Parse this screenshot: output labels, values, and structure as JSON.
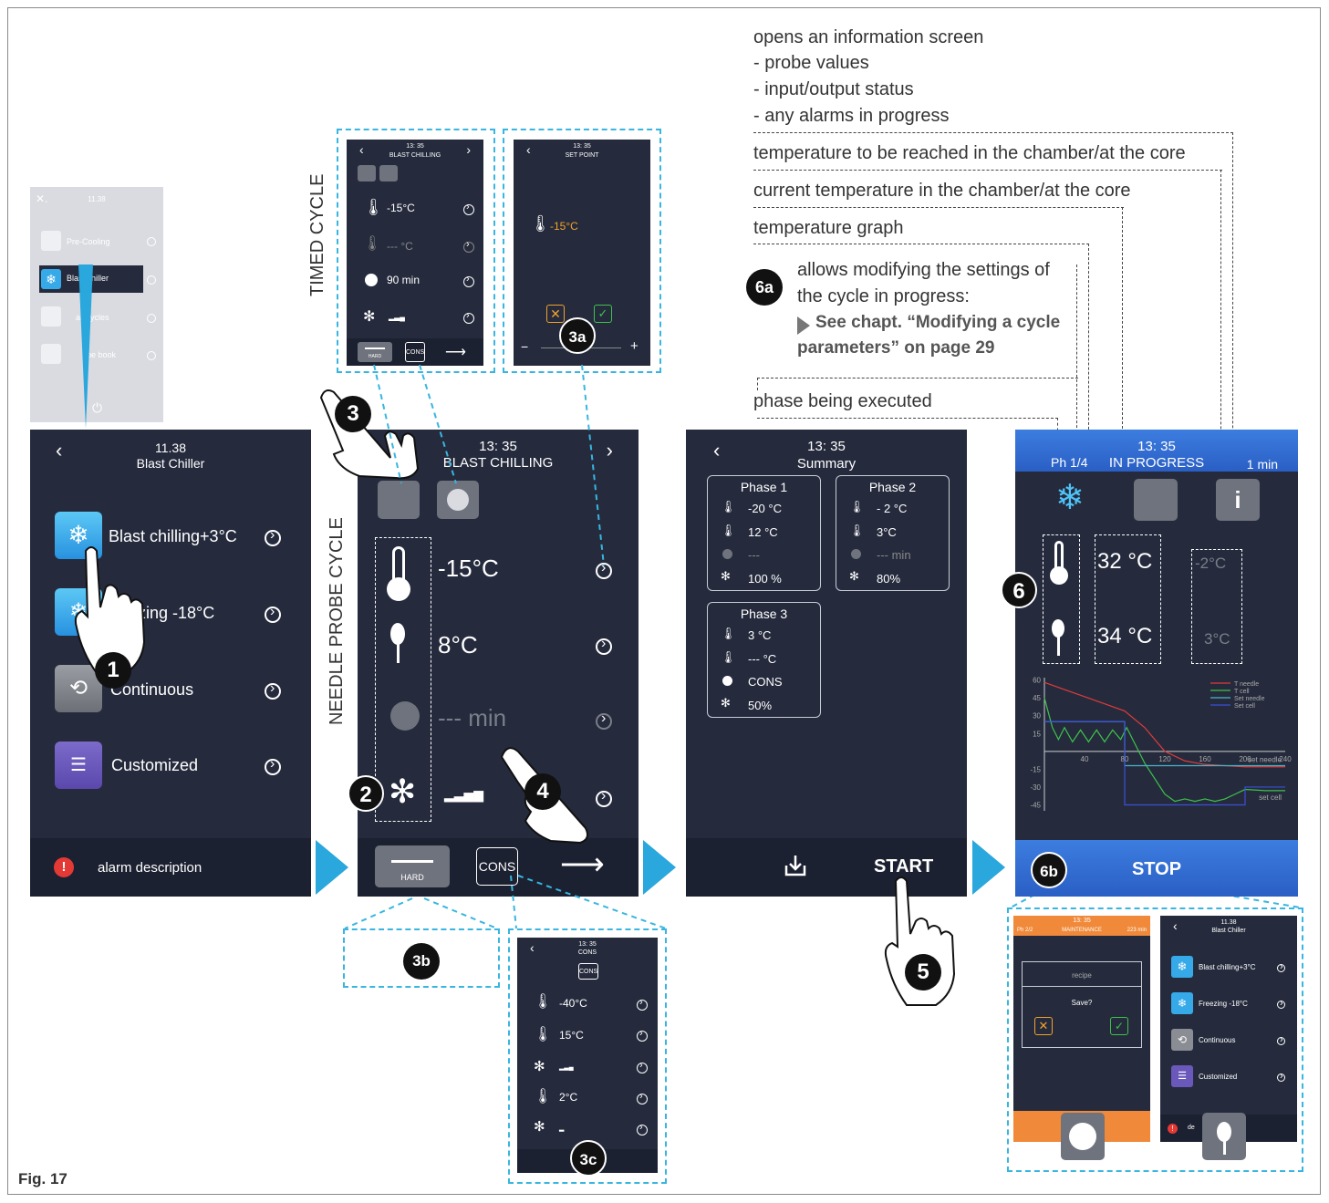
{
  "figure_label": "Fig. 17",
  "side_labels": {
    "timed": "TIMED CYCLE",
    "needle": "NEEDLE PROBE CYCLE"
  },
  "bubbles": {
    "b1": "1",
    "b2": "2",
    "b3": "3",
    "b3a": "3a",
    "b3b": "3b",
    "b3c": "3c",
    "b4": "4",
    "b5": "5",
    "b6": "6",
    "b6a": "6a",
    "b6b": "6b"
  },
  "callouts": {
    "info_title": "opens an information screen",
    "info_1": "- probe values",
    "info_2": "- input/output status",
    "info_3": "- any alarms in progress",
    "target_temp": "temperature to be reached in the chamber/at the core",
    "current_temp": "current temperature in the chamber/at the core",
    "graph": "temperature graph",
    "modify_1": "allows modifying the settings of",
    "modify_2": "the cycle in progress:",
    "see_chapt_1": "See chapt. “Modifying a cycle",
    "see_chapt_2": "parameters” on page 29",
    "phase": "phase being executed"
  },
  "home_small": {
    "time": "11.38",
    "items": [
      "Pre-Cooling",
      "Blast chiller",
      "al Cycles",
      "ipe book"
    ]
  },
  "main_menu": {
    "time": "11.38",
    "title": "Blast Chiller",
    "items": [
      "Blast chilling+3°C",
      "zing -18°C",
      "Continuous",
      "Customized"
    ],
    "alarm": "alarm description"
  },
  "timed_mini": {
    "time": "13: 35",
    "title": "BLAST CHILLING",
    "temp": "-15°C",
    "probe": "--- °C",
    "time_val": "90 min",
    "hard": "HARD",
    "cons": "CONS"
  },
  "setpoint_mini": {
    "time": "13: 35",
    "title": "SET POINT",
    "value": "-15°C",
    "minus": "−",
    "plus": "+"
  },
  "needle_screen": {
    "time": "13: 35",
    "title": "BLAST CHILLING",
    "temp": "-15°C",
    "probe": "8°C",
    "time_val": "--- min",
    "hard": "HARD",
    "cons": "CONS"
  },
  "cons_mini": {
    "time": "13: 35",
    "title": "CONS",
    "cons": "CONS",
    "rows": [
      "-40°C",
      "15°C",
      "",
      "2°C",
      ""
    ]
  },
  "summary": {
    "time": "13: 35",
    "title": "Summary",
    "start": "START",
    "phases": [
      {
        "name": "Phase 1",
        "vals": [
          "-20 °C",
          "12 °C",
          "---",
          "100 %"
        ]
      },
      {
        "name": "Phase 2",
        "vals": [
          "- 2 °C",
          "3°C",
          "--- min",
          "80%"
        ]
      },
      {
        "name": "Phase 3",
        "vals": [
          "3 °C",
          "--- °C",
          "CONS",
          "50%"
        ]
      }
    ]
  },
  "progress": {
    "time": "13: 35",
    "phase": "Ph 1/4",
    "title": "IN PROGRESS",
    "elapsed": "1 min",
    "current_chamber": "32 °C",
    "current_core": "34 °C",
    "target_chamber": "-2°C",
    "target_core": "3°C",
    "stop": "STOP",
    "legend": [
      {
        "name": "T    needle",
        "color": "#e03b3b"
      },
      {
        "name": "T    cell",
        "color": "#3ec24a"
      },
      {
        "name": "Set  needle",
        "color": "#4ab5c9"
      },
      {
        "name": "Set    cell",
        "color": "#3b4fd6"
      }
    ],
    "set_needle_label": "set needle",
    "set_cell_label": "set cell"
  },
  "chart_data": {
    "type": "line",
    "xticks": [
      40,
      80,
      120,
      160,
      200,
      240
    ],
    "yticks": [
      60,
      45,
      30,
      15,
      -15,
      -30,
      -45
    ],
    "xlim": [
      0,
      240
    ],
    "ylim": [
      -50,
      62
    ],
    "series": [
      {
        "name": "T    needle",
        "color": "#e03b3b",
        "x": [
          0,
          20,
          40,
          60,
          80,
          100,
          120,
          140,
          160,
          180,
          200,
          220,
          240
        ],
        "y": [
          58,
          52,
          46,
          40,
          34,
          20,
          0,
          -8,
          -11,
          -12,
          -13,
          -13,
          -13
        ]
      },
      {
        "name": "T    cell",
        "color": "#3ec24a",
        "x": [
          0,
          8,
          14,
          20,
          28,
          36,
          44,
          52,
          60,
          68,
          76,
          82,
          100,
          120,
          130,
          140,
          150,
          160,
          170,
          180,
          190,
          200,
          220,
          240
        ],
        "y": [
          45,
          20,
          10,
          20,
          8,
          18,
          8,
          18,
          8,
          18,
          10,
          20,
          -10,
          -36,
          -42,
          -40,
          -42,
          -40,
          -42,
          -40,
          -36,
          -32,
          -33,
          -33
        ]
      },
      {
        "name": "Set  needle",
        "color": "#4ab5c9",
        "x": [
          0,
          80,
          80,
          200,
          200,
          240
        ],
        "y": [
          25,
          25,
          -12,
          -12,
          -12,
          -12
        ]
      },
      {
        "name": "Set    cell",
        "color": "#3b4fd6",
        "x": [
          0,
          80,
          80,
          200,
          200,
          240
        ],
        "y": [
          25,
          25,
          -45,
          -45,
          -30,
          -30
        ]
      }
    ]
  },
  "maint_mini": {
    "time": "13: 35",
    "phase": "Ph 2/2",
    "title": "MAINTENANCE",
    "elapsed": "223 min",
    "recipe": "recipe",
    "save": "Save?"
  },
  "menu_mini": {
    "time": "11.38",
    "title": "Blast Chiller",
    "items": [
      "Blast chilling+3°C",
      "Freezing -18°C",
      "Continuous",
      "Customized"
    ],
    "alarm_a": "de",
    "alarm_b": "e"
  }
}
